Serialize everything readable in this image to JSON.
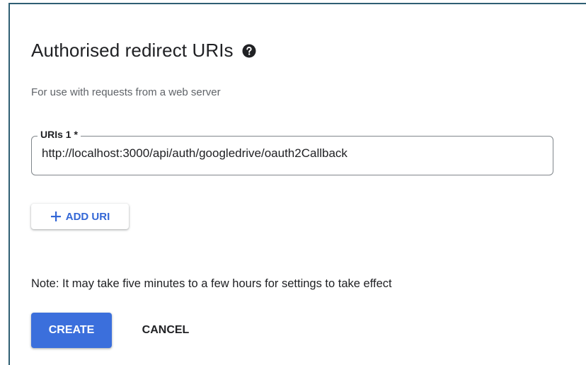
{
  "section": {
    "title": "Authorised redirect URIs",
    "help_icon": "question-circle-icon",
    "subtitle": "For use with requests from a web server"
  },
  "uri_field": {
    "label": "URIs 1 *",
    "value": "http://localhost:3000/api/auth/googledrive/oauth2Callback"
  },
  "add_uri": {
    "icon": "plus-icon",
    "label": "ADD URI"
  },
  "note": "Note: It may take five minutes to a few hours for settings to take effect",
  "actions": {
    "create_label": "CREATE",
    "cancel_label": "CANCEL"
  },
  "colors": {
    "accent": "#3b6fdc",
    "accent_text": "#3367d6",
    "frame_border": "#2f5f73"
  }
}
